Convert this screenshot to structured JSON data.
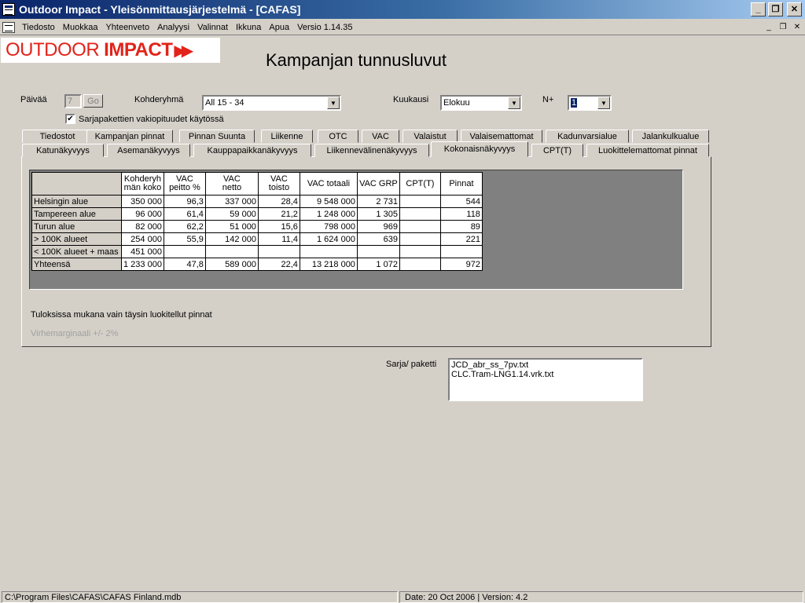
{
  "window": {
    "title": "Outdoor Impact - Yleisönmittausjärjestelmä - [CAFAS]",
    "minimize": "_",
    "restore": "❐",
    "close": "✕"
  },
  "menu": {
    "items": [
      "Tiedosto",
      "Muokkaa",
      "Yhteenveto",
      "Analyysi",
      "Valinnat",
      "Ikkuna",
      "Apua",
      "Versio 1.14.35"
    ],
    "mdi_minimize": "_",
    "mdi_restore": "❐",
    "mdi_close": "✕"
  },
  "logo": {
    "word1": "OUTDOOR",
    "word2": "IMPACT",
    "arrows": "▶▶"
  },
  "page_title": "Kampanjan tunnusluvut",
  "controls": {
    "day_label": "Päivää",
    "day_value": "7",
    "go_label": "Go",
    "target_label": "Kohderyhmä",
    "target_value": "All 15 - 34",
    "month_label": "Kuukausi",
    "month_value": "Elokuu",
    "n_label": "N+",
    "n_value": "1",
    "checkbox_label": "Sarjapakettien vakiopituudet käytössä",
    "checkbox_mark": "✔"
  },
  "tabs_row1": [
    "Tiedostot",
    "Kampanjan pinnat",
    "Pinnan Suunta",
    "Liikenne",
    "OTC",
    "VAC",
    "Valaistut",
    "Valaisemattomat",
    "Kadunvarsialue",
    "Jalankulkualue"
  ],
  "tabs_row2": [
    "Katunäkyvyys",
    "Asemanäkyvyys",
    "Kauppapaikkanäkyvyys",
    "Liikennevälinenäkyvyys",
    "Kokonaisnäkyvyys",
    "CPT(T)",
    "Luokittelemattomat pinnat"
  ],
  "active_tab": "Kokonaisnäkyvyys",
  "table": {
    "headers": [
      {
        "l1": "Kohderyh",
        "l2": "män koko"
      },
      {
        "l1": "VAC",
        "l2": "peitto %"
      },
      {
        "l1": "VAC",
        "l2": "netto"
      },
      {
        "l1": "VAC",
        "l2": "toisto"
      },
      {
        "l1": "VAC totaali",
        "l2": ""
      },
      {
        "l1": "VAC GRP",
        "l2": ""
      },
      {
        "l1": "CPT(T)",
        "l2": ""
      },
      {
        "l1": "Pinnat",
        "l2": ""
      }
    ],
    "rows": [
      {
        "label": "Helsingin alue",
        "cells": [
          "350 000",
          "96,3",
          "337 000",
          "28,4",
          "9 548 000",
          "2 731",
          "",
          "544"
        ]
      },
      {
        "label": "Tampereen alue",
        "cells": [
          "96 000",
          "61,4",
          "59 000",
          "21,2",
          "1 248 000",
          "1 305",
          "",
          "118"
        ]
      },
      {
        "label": "Turun alue",
        "cells": [
          "82 000",
          "62,2",
          "51 000",
          "15,6",
          "798 000",
          "969",
          "",
          "89"
        ]
      },
      {
        "label": "> 100K alueet",
        "cells": [
          "254 000",
          "55,9",
          "142 000",
          "11,4",
          "1 624 000",
          "639",
          "",
          "221"
        ]
      },
      {
        "label": "< 100K alueet + maas",
        "cells": [
          "451 000",
          "",
          "",
          "",
          "",
          "",
          "",
          ""
        ]
      },
      {
        "label": "Yhteensä",
        "cells": [
          "1 233 000",
          "47,8",
          "589 000",
          "22,4",
          "13 218 000",
          "1 072",
          "",
          "972"
        ]
      }
    ]
  },
  "note": "Tuloksissa mukana vain täysin luokitellut pinnat",
  "error_margin": "Virhemarginaali +/- 2%",
  "series": {
    "label": "Sarja/ paketti",
    "items": [
      "JCD_abr_ss_7pv.txt",
      "CLC.Tram-LNG1.14.vrk.txt"
    ]
  },
  "status": {
    "path": "C:\\Program Files\\CAFAS\\CAFAS Finland.mdb",
    "date": "Date:  20 Oct 2006   |   Version:  4.2"
  }
}
